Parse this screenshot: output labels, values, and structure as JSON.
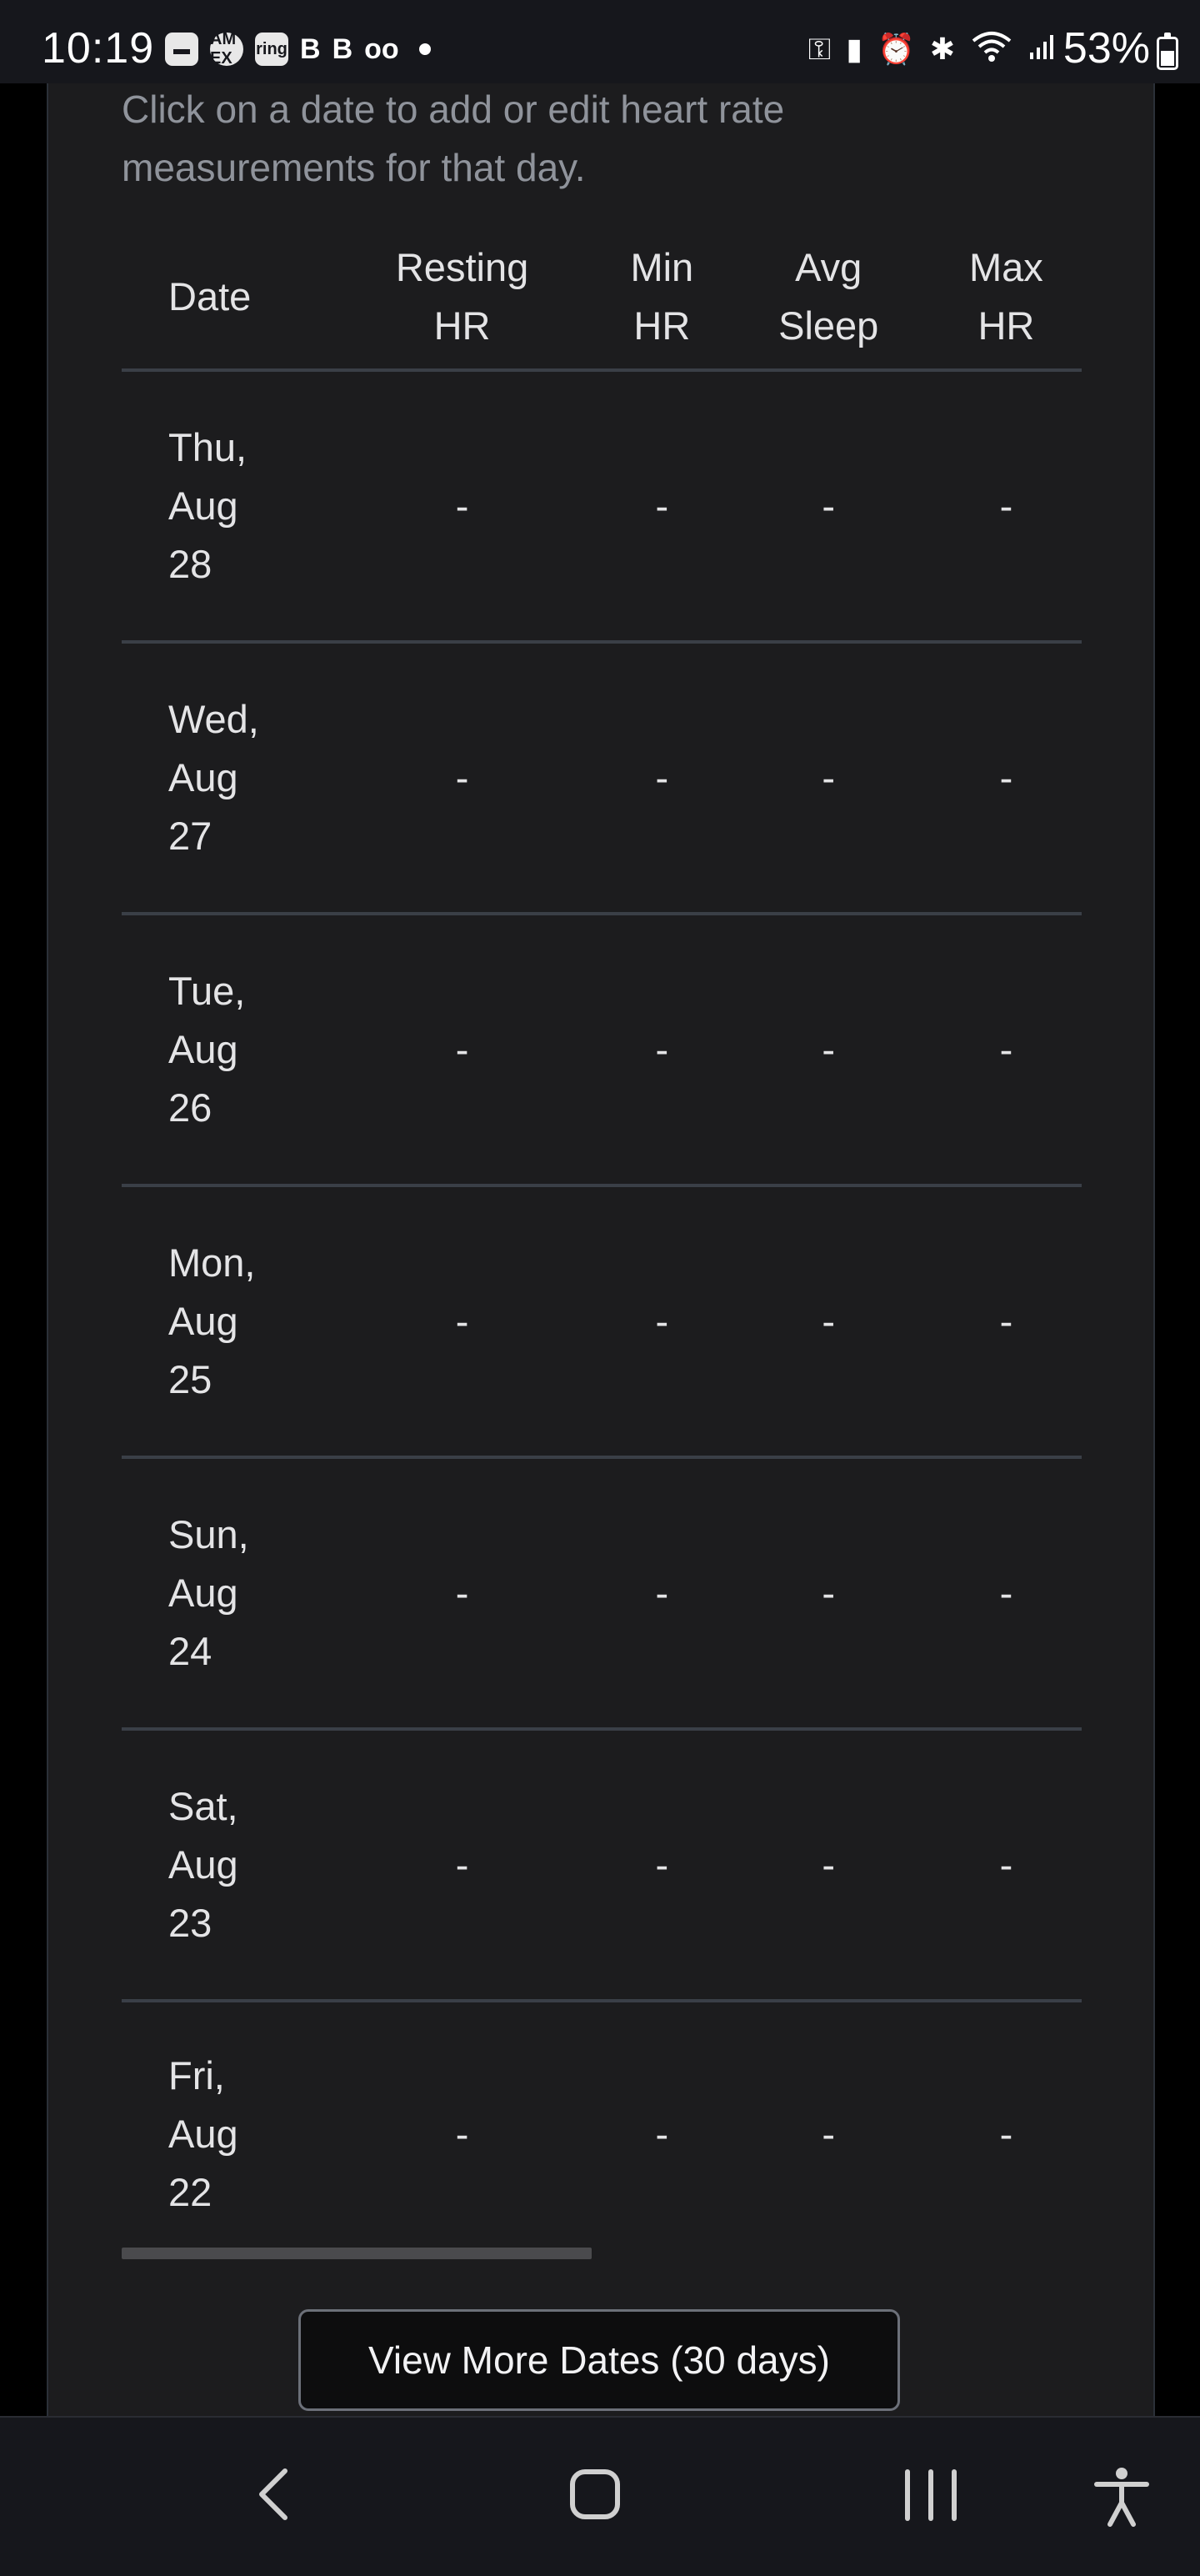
{
  "status_bar": {
    "time": "10:19",
    "left_icons": [
      "card-icon",
      "amex-icon",
      "ring-icon",
      "b-app-icon",
      "b-mail-icon",
      "voicemail-icon"
    ],
    "amex_label": "AM EX",
    "ring_label": "ring",
    "b_label": "B",
    "voicemail_label": "oo",
    "right_icons": [
      "key-icon",
      "battery-saver-icon",
      "alarm-icon",
      "bluetooth-icon",
      "wifi-icon",
      "signal-icon"
    ],
    "battery_percent": "53%",
    "battery_level": 0.53
  },
  "instructions": "Click on a date to add or edit heart rate measurements for that day.",
  "table": {
    "headers": {
      "date": "Date",
      "resting_hr": [
        "Resting",
        "HR"
      ],
      "min_hr": [
        "Min",
        "HR"
      ],
      "avg_sleep": [
        "Avg",
        "Sleep"
      ],
      "max_hr": [
        "Max",
        "HR"
      ]
    },
    "rows": [
      {
        "date": [
          "Thu,",
          "Aug",
          "28"
        ],
        "resting": "-",
        "min": "-",
        "avg_sleep": "-",
        "max": "-"
      },
      {
        "date": [
          "Wed,",
          "Aug",
          "27"
        ],
        "resting": "-",
        "min": "-",
        "avg_sleep": "-",
        "max": "-"
      },
      {
        "date": [
          "Tue,",
          "Aug",
          "26"
        ],
        "resting": "-",
        "min": "-",
        "avg_sleep": "-",
        "max": "-"
      },
      {
        "date": [
          "Mon,",
          "Aug",
          "25"
        ],
        "resting": "-",
        "min": "-",
        "avg_sleep": "-",
        "max": "-"
      },
      {
        "date": [
          "Sun,",
          "Aug",
          "24"
        ],
        "resting": "-",
        "min": "-",
        "avg_sleep": "-",
        "max": "-"
      },
      {
        "date": [
          "Sat,",
          "Aug",
          "23"
        ],
        "resting": "-",
        "min": "-",
        "avg_sleep": "-",
        "max": "-"
      },
      {
        "date": [
          "Fri,",
          "Aug",
          "22"
        ],
        "resting": "-",
        "min": "-",
        "avg_sleep": "-",
        "max": "-"
      }
    ]
  },
  "view_more_button": "View More Dates (30 days)",
  "nav_bar": {
    "buttons": [
      "back-icon",
      "home-icon",
      "recent-apps-icon",
      "accessibility-icon"
    ]
  },
  "colors": {
    "background": "#000000",
    "card": "#1c1c1e",
    "divider": "#3a3f47",
    "muted_text": "#8f939b",
    "text": "#e4e4e6"
  }
}
